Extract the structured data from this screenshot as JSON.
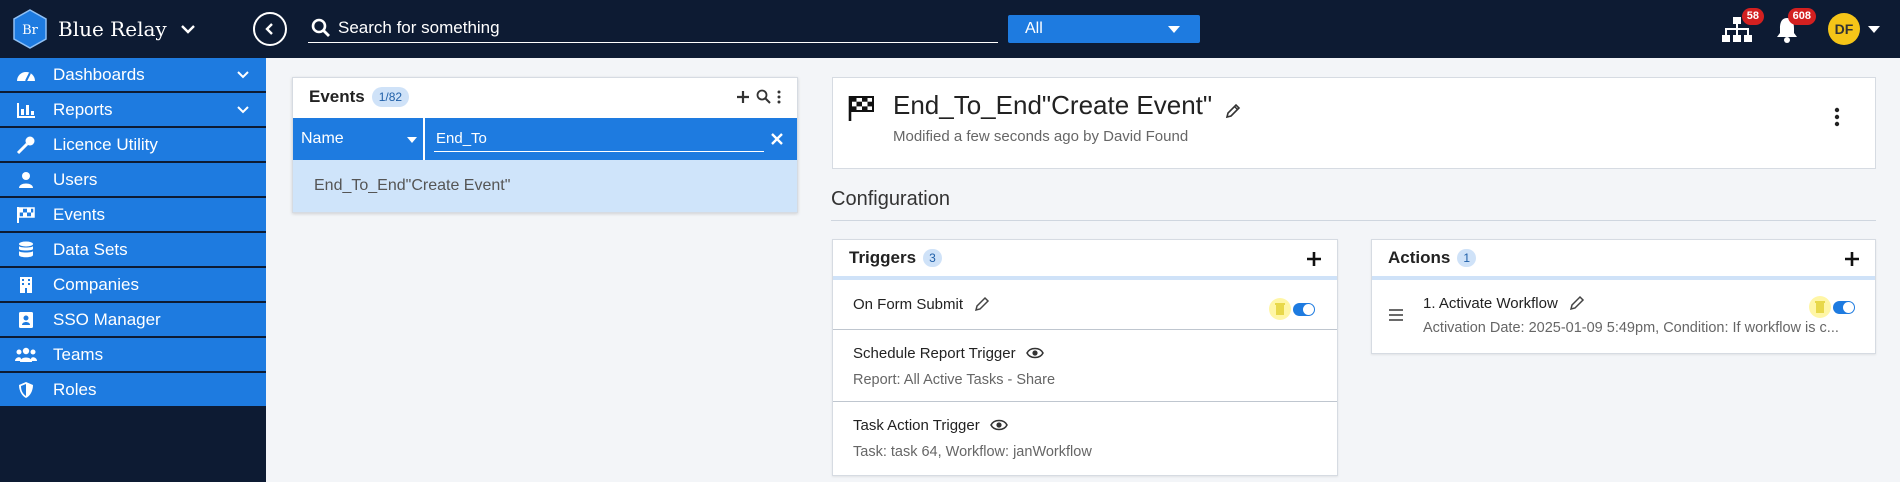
{
  "app": {
    "brand_name": "Blue Relay",
    "logo_text": "Br"
  },
  "topbar": {
    "search_placeholder": "Search for something",
    "scope": "All",
    "hierarchy_badge": "58",
    "notifications_badge": "608",
    "avatar_initials": "DF"
  },
  "sidebar": {
    "items": [
      {
        "label": "Dashboards",
        "icon": "gauge-icon",
        "expandable": true
      },
      {
        "label": "Reports",
        "icon": "bar-chart-icon",
        "expandable": true
      },
      {
        "label": "Licence Utility",
        "icon": "key-icon",
        "expandable": false
      },
      {
        "label": "Users",
        "icon": "user-icon",
        "expandable": false
      },
      {
        "label": "Events",
        "icon": "flag-icon",
        "expandable": false
      },
      {
        "label": "Data Sets",
        "icon": "database-icon",
        "expandable": false
      },
      {
        "label": "Companies",
        "icon": "building-icon",
        "expandable": false
      },
      {
        "label": "SSO Manager",
        "icon": "id-badge-icon",
        "expandable": false
      },
      {
        "label": "Teams",
        "icon": "users-icon",
        "expandable": false
      },
      {
        "label": "Roles",
        "icon": "shield-icon",
        "expandable": false
      }
    ]
  },
  "events_panel": {
    "title": "Events",
    "count": "1/82",
    "filter_field": "Name",
    "filter_value": "End_To",
    "results": [
      "End_To_End\"Create Event\""
    ]
  },
  "detail": {
    "title": "End_To_End\"Create Event\"",
    "modified": "Modified a few seconds ago by David Found"
  },
  "configuration": {
    "title": "Configuration",
    "triggers": {
      "title": "Triggers",
      "count": "3",
      "items": [
        {
          "title": "On Form Submit",
          "subtitle": "",
          "icon": "pencil-icon",
          "toggle": true
        },
        {
          "title": "Schedule Report Trigger",
          "subtitle": "Report: All Active Tasks - Share",
          "icon": "eye-icon"
        },
        {
          "title": "Task Action Trigger",
          "subtitle": "Task: task 64, Workflow: janWorkflow",
          "icon": "eye-icon"
        }
      ]
    },
    "actions": {
      "title": "Actions",
      "count": "1",
      "items": [
        {
          "title": "1. Activate Workflow",
          "subtitle": "Activation Date: 2025-01-09 5:49pm, Condition: If workflow is c...",
          "toggle": true
        }
      ]
    }
  }
}
